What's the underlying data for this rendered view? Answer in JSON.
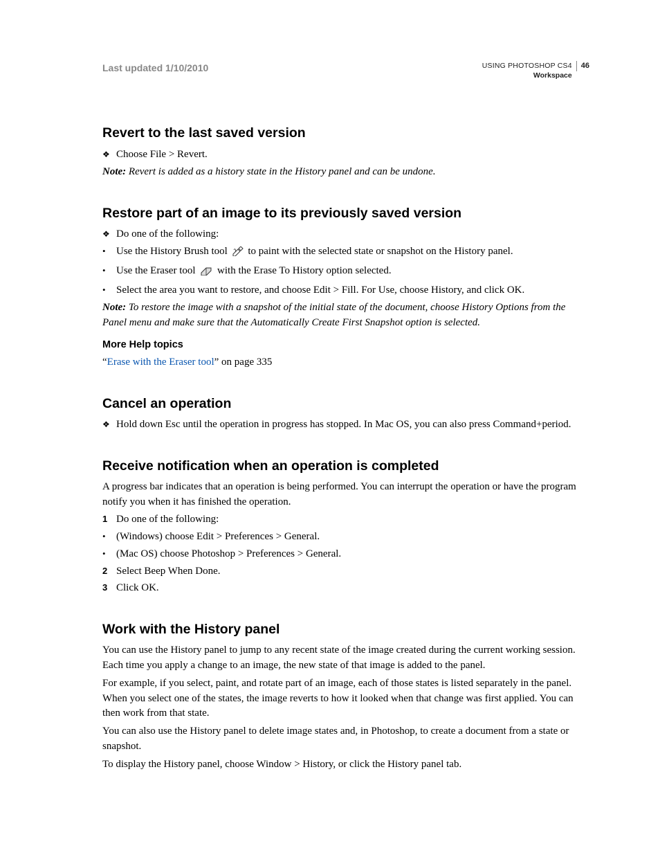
{
  "header": {
    "updated": "Last updated 1/10/2010",
    "product": "USING PHOTOSHOP CS4",
    "section": "Workspace",
    "page": "46"
  },
  "sections": {
    "revert": {
      "heading": "Revert to the last saved version",
      "step1": "Choose File > Revert.",
      "note_label": "Note:",
      "note_body": " Revert is added as a history state in the History panel and can be undone."
    },
    "restore": {
      "heading": "Restore part of an image to its previously saved version",
      "step1": "Do one of the following:",
      "bullet1a": "Use the History Brush tool ",
      "bullet1b": " to paint with the selected state or snapshot on the History panel.",
      "bullet2a": "Use the Eraser tool ",
      "bullet2b": " with the Erase To History option selected.",
      "bullet3": "Select the area you want to restore, and choose Edit > Fill. For Use, choose History, and click OK.",
      "note_label": "Note:",
      "note_body": " To restore the image with a snapshot of the initial state of the document, choose History Options from the Panel menu and make sure that the Automatically Create First Snapshot option is selected.",
      "more_help": "More Help topics",
      "link_pre": "“",
      "link_text": "Erase with the Eraser tool",
      "link_post": "” on page 335"
    },
    "cancel": {
      "heading": "Cancel an operation",
      "step1": "Hold down Esc until the operation in progress has stopped. In Mac OS, you can also press Command+period."
    },
    "notify": {
      "heading": "Receive notification when an operation is completed",
      "intro": "A progress bar indicates that an operation is being performed. You can interrupt the operation or have the program notify you when it has finished the operation.",
      "n1": "Do one of the following:",
      "b1": "(Windows) choose Edit > Preferences > General.",
      "b2": "(Mac OS) choose Photoshop > Preferences > General.",
      "n2": "Select Beep When Done.",
      "n3": "Click OK."
    },
    "history": {
      "heading": "Work with the History panel",
      "p1": "You can use the History panel to jump to any recent state of the image created during the current working session. Each time you apply a change to an image, the new state of that image is added to the panel.",
      "p2": "For example, if you select, paint, and rotate part of an image, each of those states is listed separately in the panel. When you select one of the states, the image reverts to how it looked when that change was first applied. You can then work from that state.",
      "p3": "You can also use the History panel to delete image states and, in Photoshop, to create a document from a state or snapshot.",
      "p4": "To display the History panel, choose Window > History, or click the History panel tab."
    }
  },
  "markers": {
    "diamond": "❖",
    "dot": "•",
    "m1": "1",
    "m2": "2",
    "m3": "3"
  },
  "icons": {
    "history_brush": "history-brush-icon",
    "eraser": "eraser-icon"
  }
}
